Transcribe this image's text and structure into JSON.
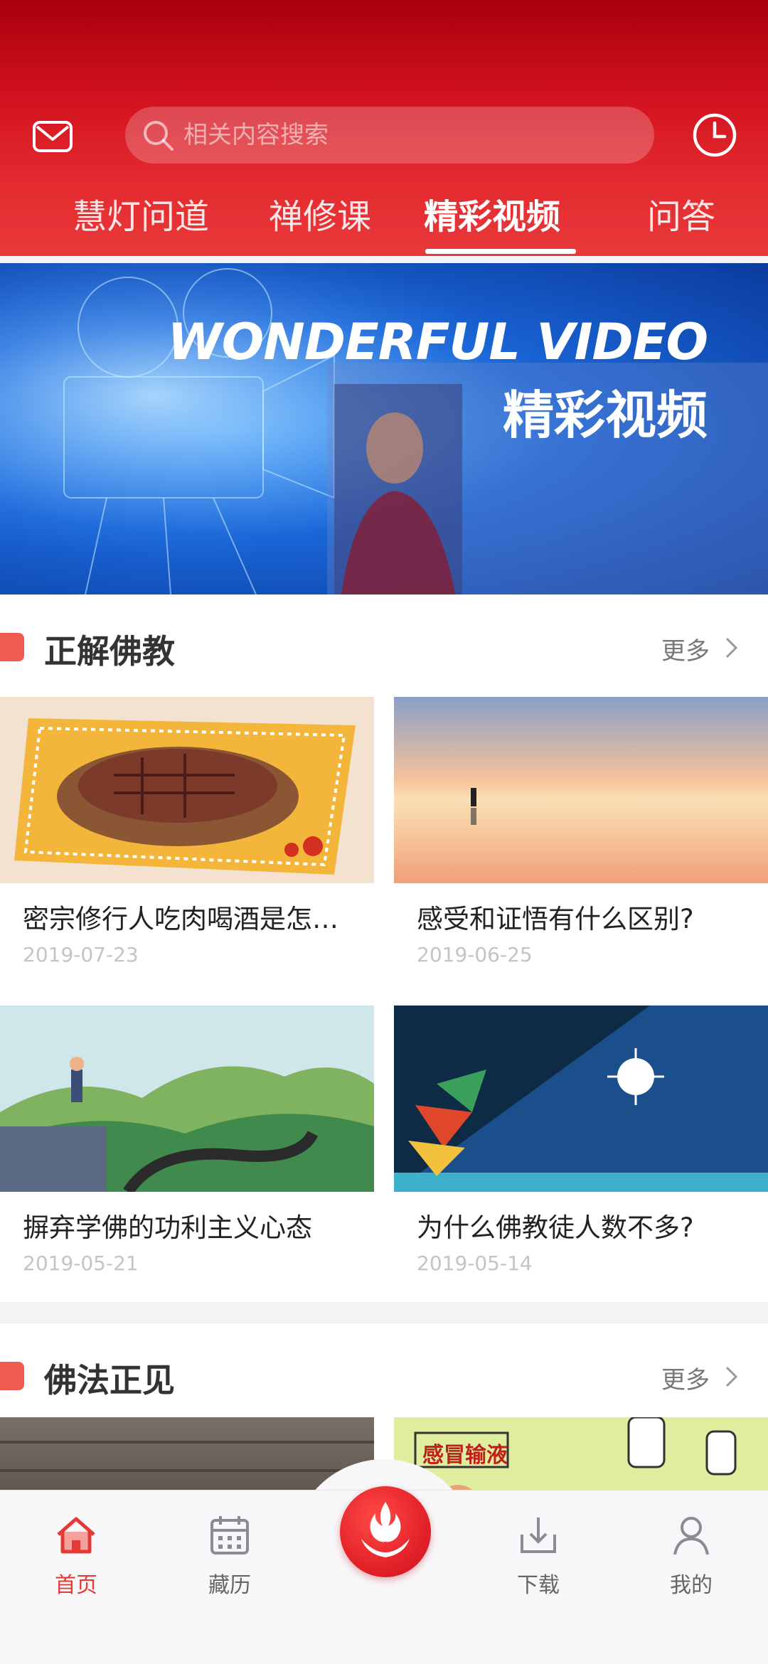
{
  "search": {
    "placeholder": "相关内容搜索"
  },
  "tabs": [
    {
      "label": "慧灯问道"
    },
    {
      "label": "禅修课"
    },
    {
      "label": "精彩视频",
      "active": true
    },
    {
      "label": "问答"
    }
  ],
  "banner": {
    "title_en": "WONDERFUL VIDEO",
    "title_cn": "精彩视频"
  },
  "sections": [
    {
      "title": "正解佛教",
      "more": "更多",
      "cards": [
        {
          "title": "密宗修行人吃肉喝酒是怎…",
          "date": "2019-07-23"
        },
        {
          "title": "感受和证悟有什么区别?",
          "date": "2019-06-25"
        },
        {
          "title": "摒弃学佛的功利主义心态",
          "date": "2019-05-21"
        },
        {
          "title": "为什么佛教徒人数不多?",
          "date": "2019-05-14"
        }
      ]
    },
    {
      "title": "佛法正见",
      "more": "更多",
      "cards": [
        {
          "thumb_text": "感冒输液"
        }
      ]
    }
  ],
  "nav": [
    {
      "label": "首页",
      "icon": "home-icon",
      "active": true
    },
    {
      "label": "藏历",
      "icon": "calendar-icon"
    },
    {
      "label": "",
      "icon": "lotus-flame-logo-icon"
    },
    {
      "label": "下载",
      "icon": "download-icon"
    },
    {
      "label": "我的",
      "icon": "user-icon"
    }
  ],
  "colors": {
    "brand_red": "#e32a2f",
    "accent": "#ef5b4f"
  }
}
